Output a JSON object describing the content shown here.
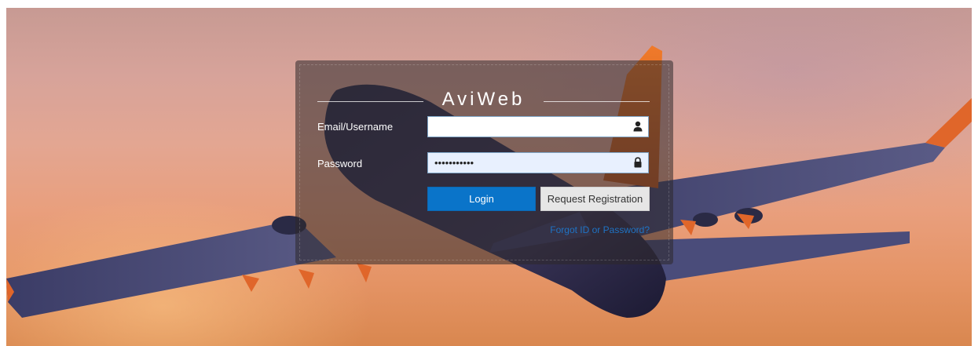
{
  "app": {
    "title": "AviWeb"
  },
  "login": {
    "username_label": "Email/Username",
    "username_value": "",
    "password_label": "Password",
    "password_value": "password123",
    "login_button": "Login",
    "register_button": "Request Registration",
    "forgot_link": "Forgot ID or Password?"
  },
  "icons": {
    "username_icon": "user-icon",
    "password_icon": "lock-icon"
  },
  "colors": {
    "login_button": "#0a74c9",
    "link": "#1f73c4",
    "panel_overlay": "rgba(45,40,42,0.55)"
  }
}
